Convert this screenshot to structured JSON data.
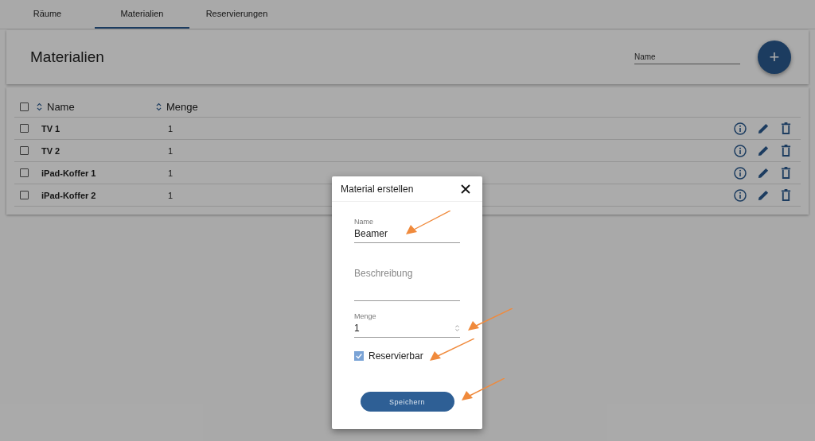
{
  "tabs": [
    {
      "label": "Räume",
      "selected": false
    },
    {
      "label": "Materialien",
      "selected": true
    },
    {
      "label": "Reservierungen",
      "selected": false
    }
  ],
  "header": {
    "title": "Materialien",
    "search": {
      "placeholder": "Name"
    },
    "add_button": "+"
  },
  "table": {
    "select_all": {
      "checked": false
    },
    "columns": [
      {
        "label": "Name",
        "sortable": true
      },
      {
        "label": "Menge",
        "sortable": true
      }
    ],
    "rows": [
      {
        "checked": false,
        "cells": [
          "TV 1",
          "1"
        ]
      },
      {
        "checked": false,
        "cells": [
          "TV 2",
          "1"
        ]
      },
      {
        "checked": false,
        "cells": [
          "iPad-Koffer 1",
          "1"
        ]
      },
      {
        "checked": false,
        "cells": [
          "iPad-Koffer 2",
          "1"
        ]
      }
    ]
  },
  "dialog": {
    "title": "Material erstellen",
    "fields": [
      {
        "kind": "text",
        "label": "Name",
        "value": "Beamer"
      },
      {
        "kind": "textarea",
        "placeholder": "Beschreibung"
      },
      {
        "kind": "number",
        "label": "Menge",
        "value": "1"
      }
    ],
    "checkbox": {
      "label": "Reservierbar",
      "checked": true
    },
    "button": "Speichern"
  }
}
